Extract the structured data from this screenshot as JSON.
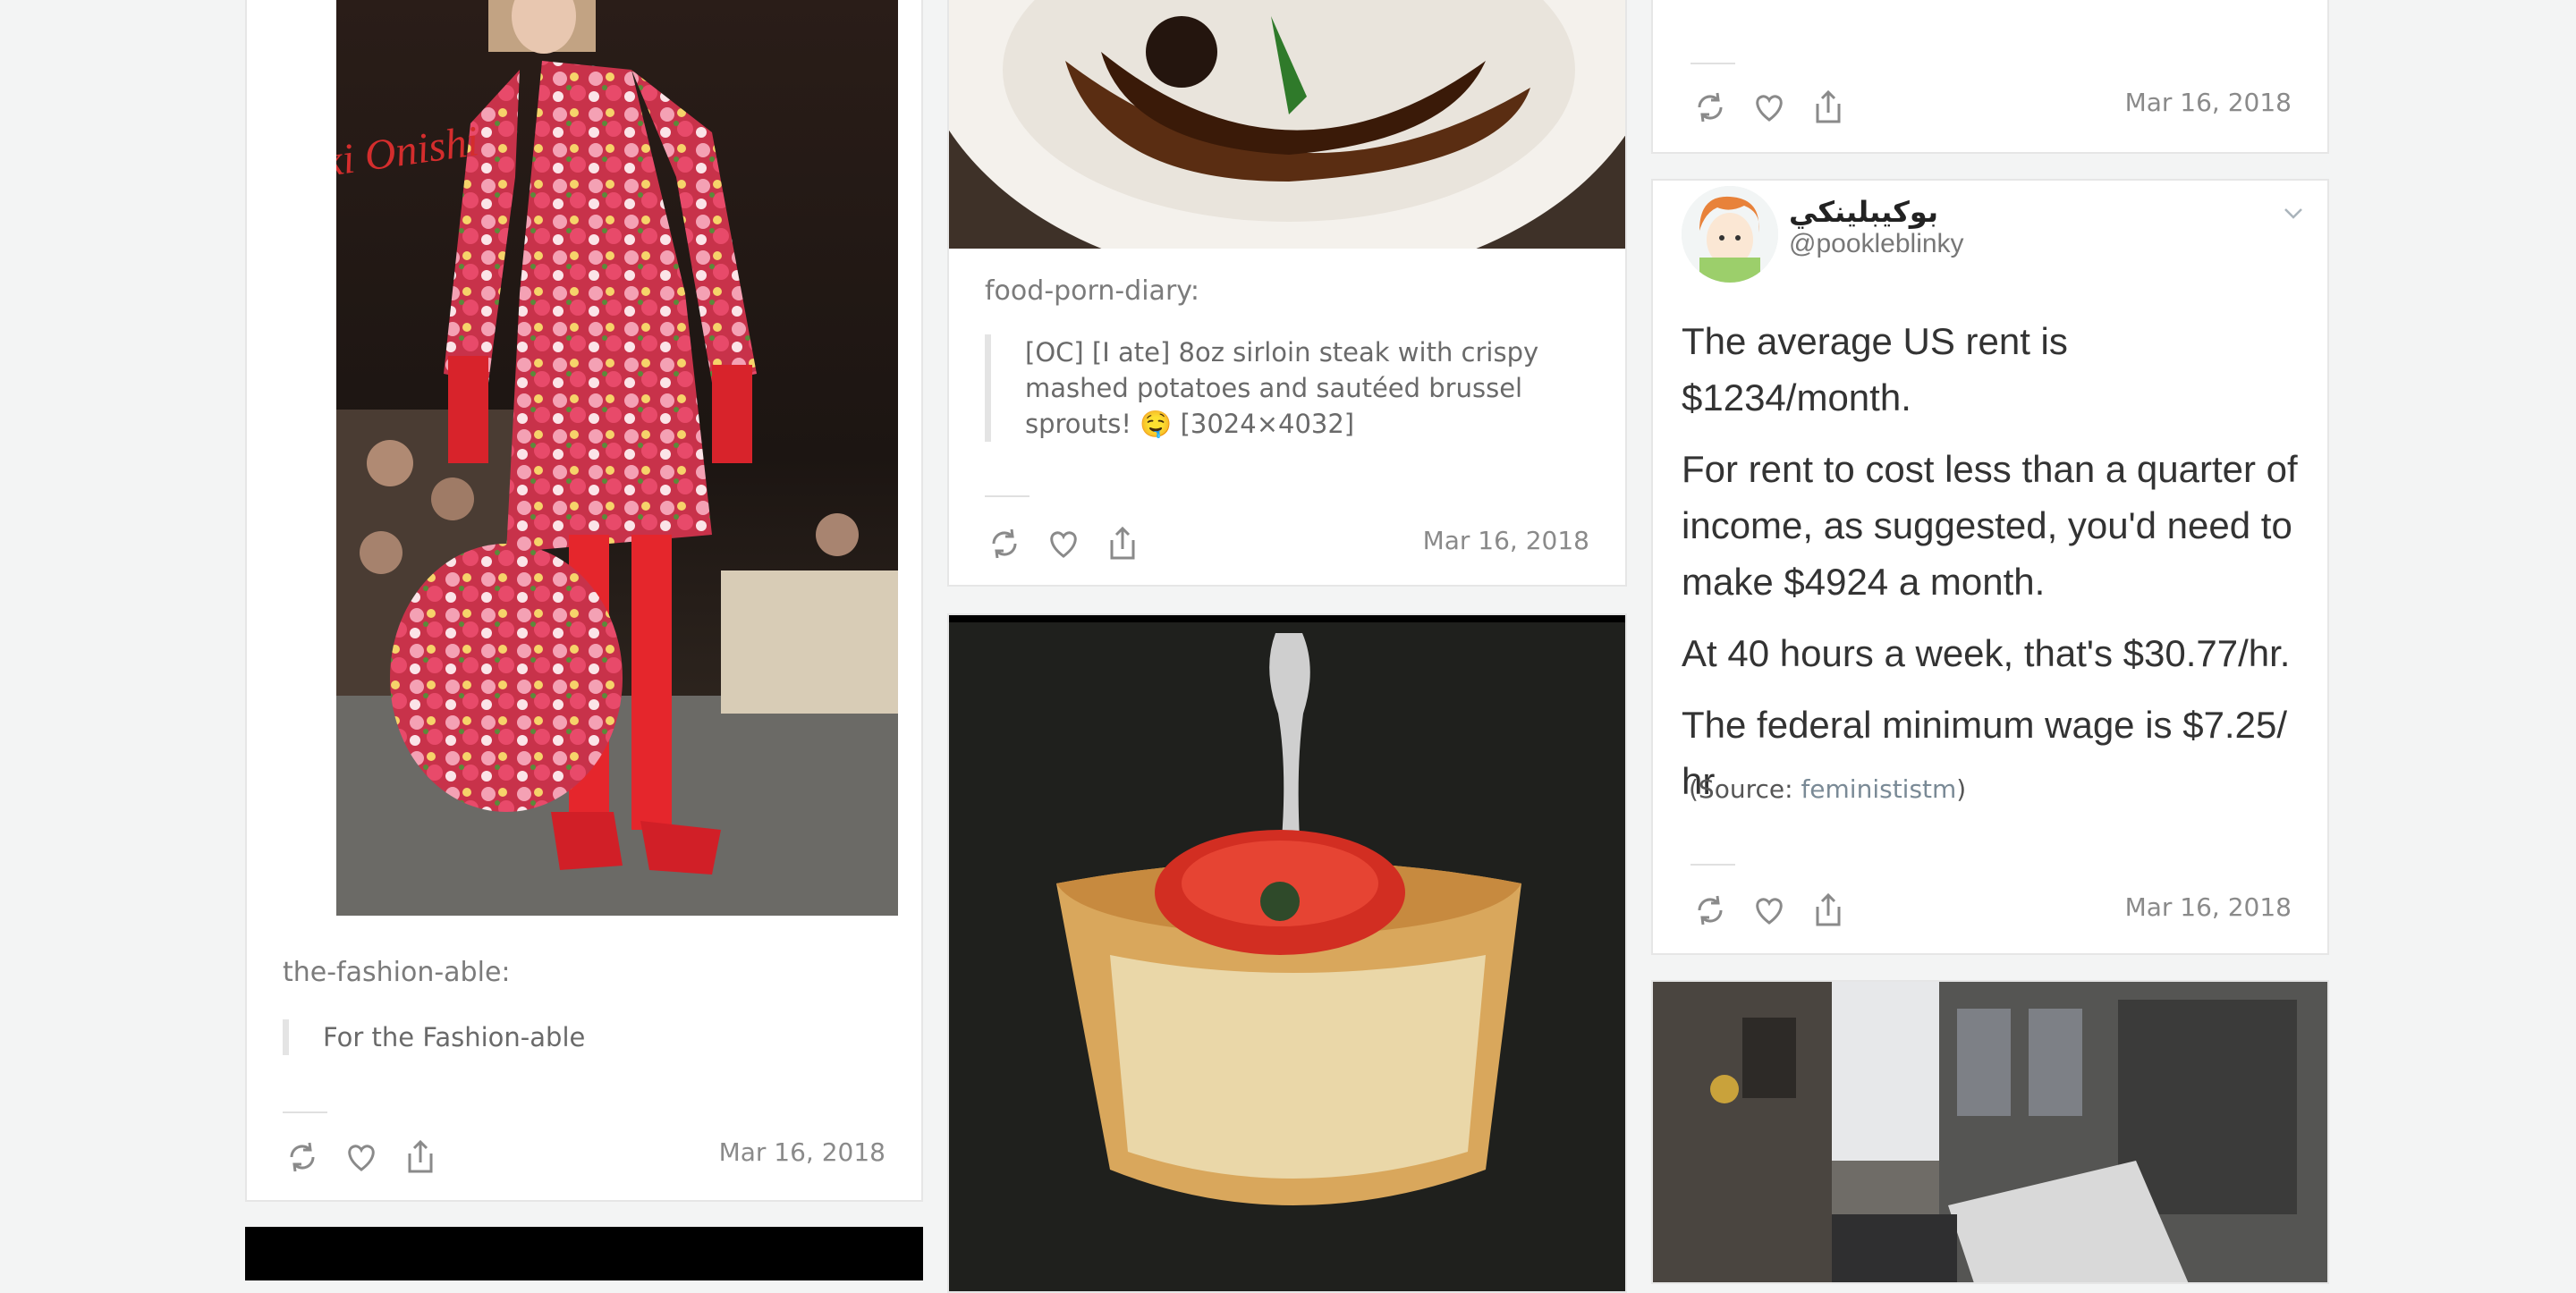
{
  "posts": [
    {
      "source": "the-fashion-able:",
      "quote": "For the Fashion-able",
      "image_overlay": "Atsuki Onishi",
      "date": "Mar 16, 2018"
    },
    {
      "source": "food-porn-diary:",
      "quote": "[OC] [I ate] 8oz sirloin steak with crispy mashed potatoes and sautéed brussel sprouts! 🤤 [3024×4032]",
      "date": "Mar 16, 2018"
    },
    {
      "date": "Mar 16, 2018"
    },
    {
      "tweet": {
        "display_name": "بوكيبلينكي",
        "handle": "@pookleblinky",
        "lines": [
          "The average US rent is $1234/month.",
          "For rent to cost less than a quarter of income, as suggested, you'd need to make $4924 a month.",
          "At 40 hours a week, that's $30.77/hr.",
          "The federal minimum wage is $7.25/ hr"
        ]
      },
      "source_prefix": "(Source: ",
      "source_link": "feminististm",
      "source_suffix": ")",
      "date": "Mar 16, 2018"
    }
  ],
  "icons": [
    "reblog-icon",
    "like-icon",
    "share-icon",
    "chevron-down-icon"
  ]
}
